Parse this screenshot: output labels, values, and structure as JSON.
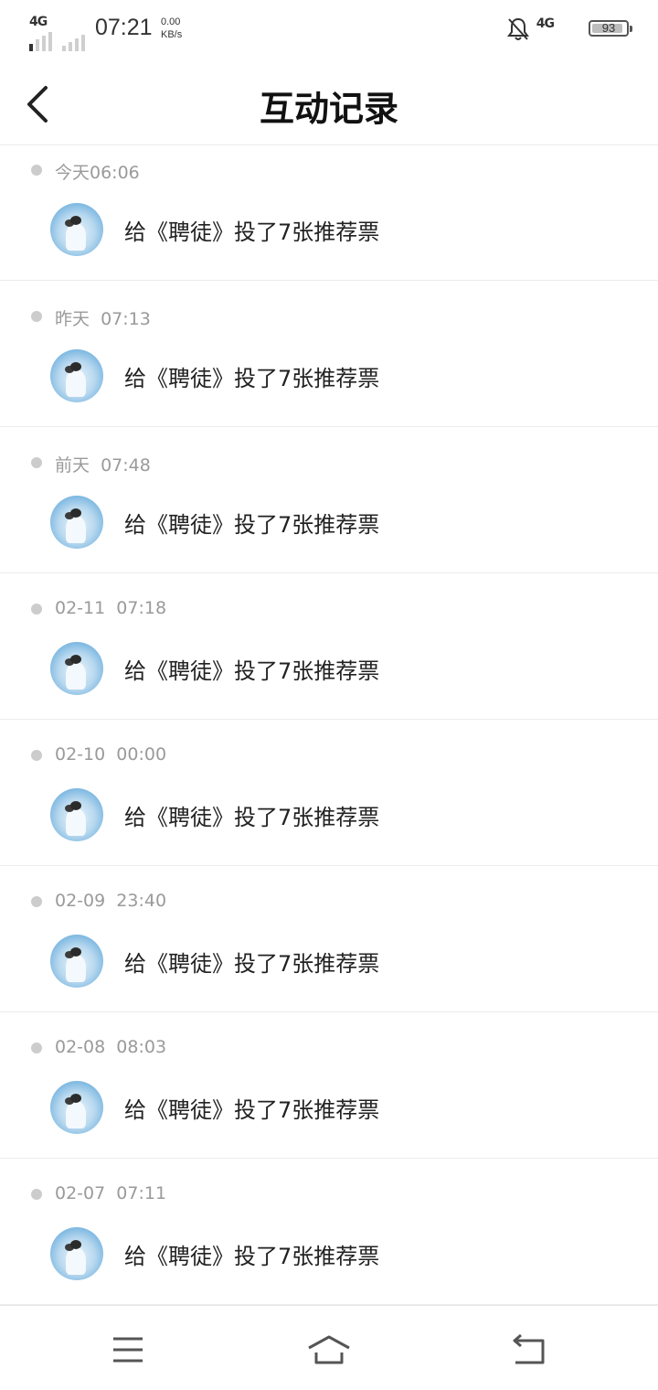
{
  "status_bar": {
    "network_left": "4G",
    "time": "07:21",
    "speed_value": "0.00",
    "speed_unit": "KB/s",
    "network_right": "4G",
    "battery": "93",
    "battery_level": 0.93
  },
  "header": {
    "title": "互动记录"
  },
  "records": [
    {
      "time": "今天06:06",
      "text": "给《聘徒》投了7张推荐票"
    },
    {
      "time": "昨天  07:13",
      "text": "给《聘徒》投了7张推荐票"
    },
    {
      "time": "前天  07:48",
      "text": "给《聘徒》投了7张推荐票"
    },
    {
      "time": "02-11  07:18",
      "text": "给《聘徒》投了7张推荐票"
    },
    {
      "time": "02-10  00:00",
      "text": "给《聘徒》投了7张推荐票"
    },
    {
      "time": "02-09  23:40",
      "text": "给《聘徒》投了7张推荐票"
    },
    {
      "time": "02-08  08:03",
      "text": "给《聘徒》投了7张推荐票"
    },
    {
      "time": "02-07  07:11",
      "text": "给《聘徒》投了7张推荐票"
    }
  ],
  "nav": {
    "items": [
      {
        "icon": "menu-icon"
      },
      {
        "icon": "home-icon"
      },
      {
        "icon": "back-return-icon"
      }
    ]
  },
  "colors": {
    "text_primary": "#222222",
    "text_secondary": "#9a9a9a",
    "divider": "#ececec",
    "dot": "#cccccc",
    "avatar_blue": "#6fb0de"
  }
}
